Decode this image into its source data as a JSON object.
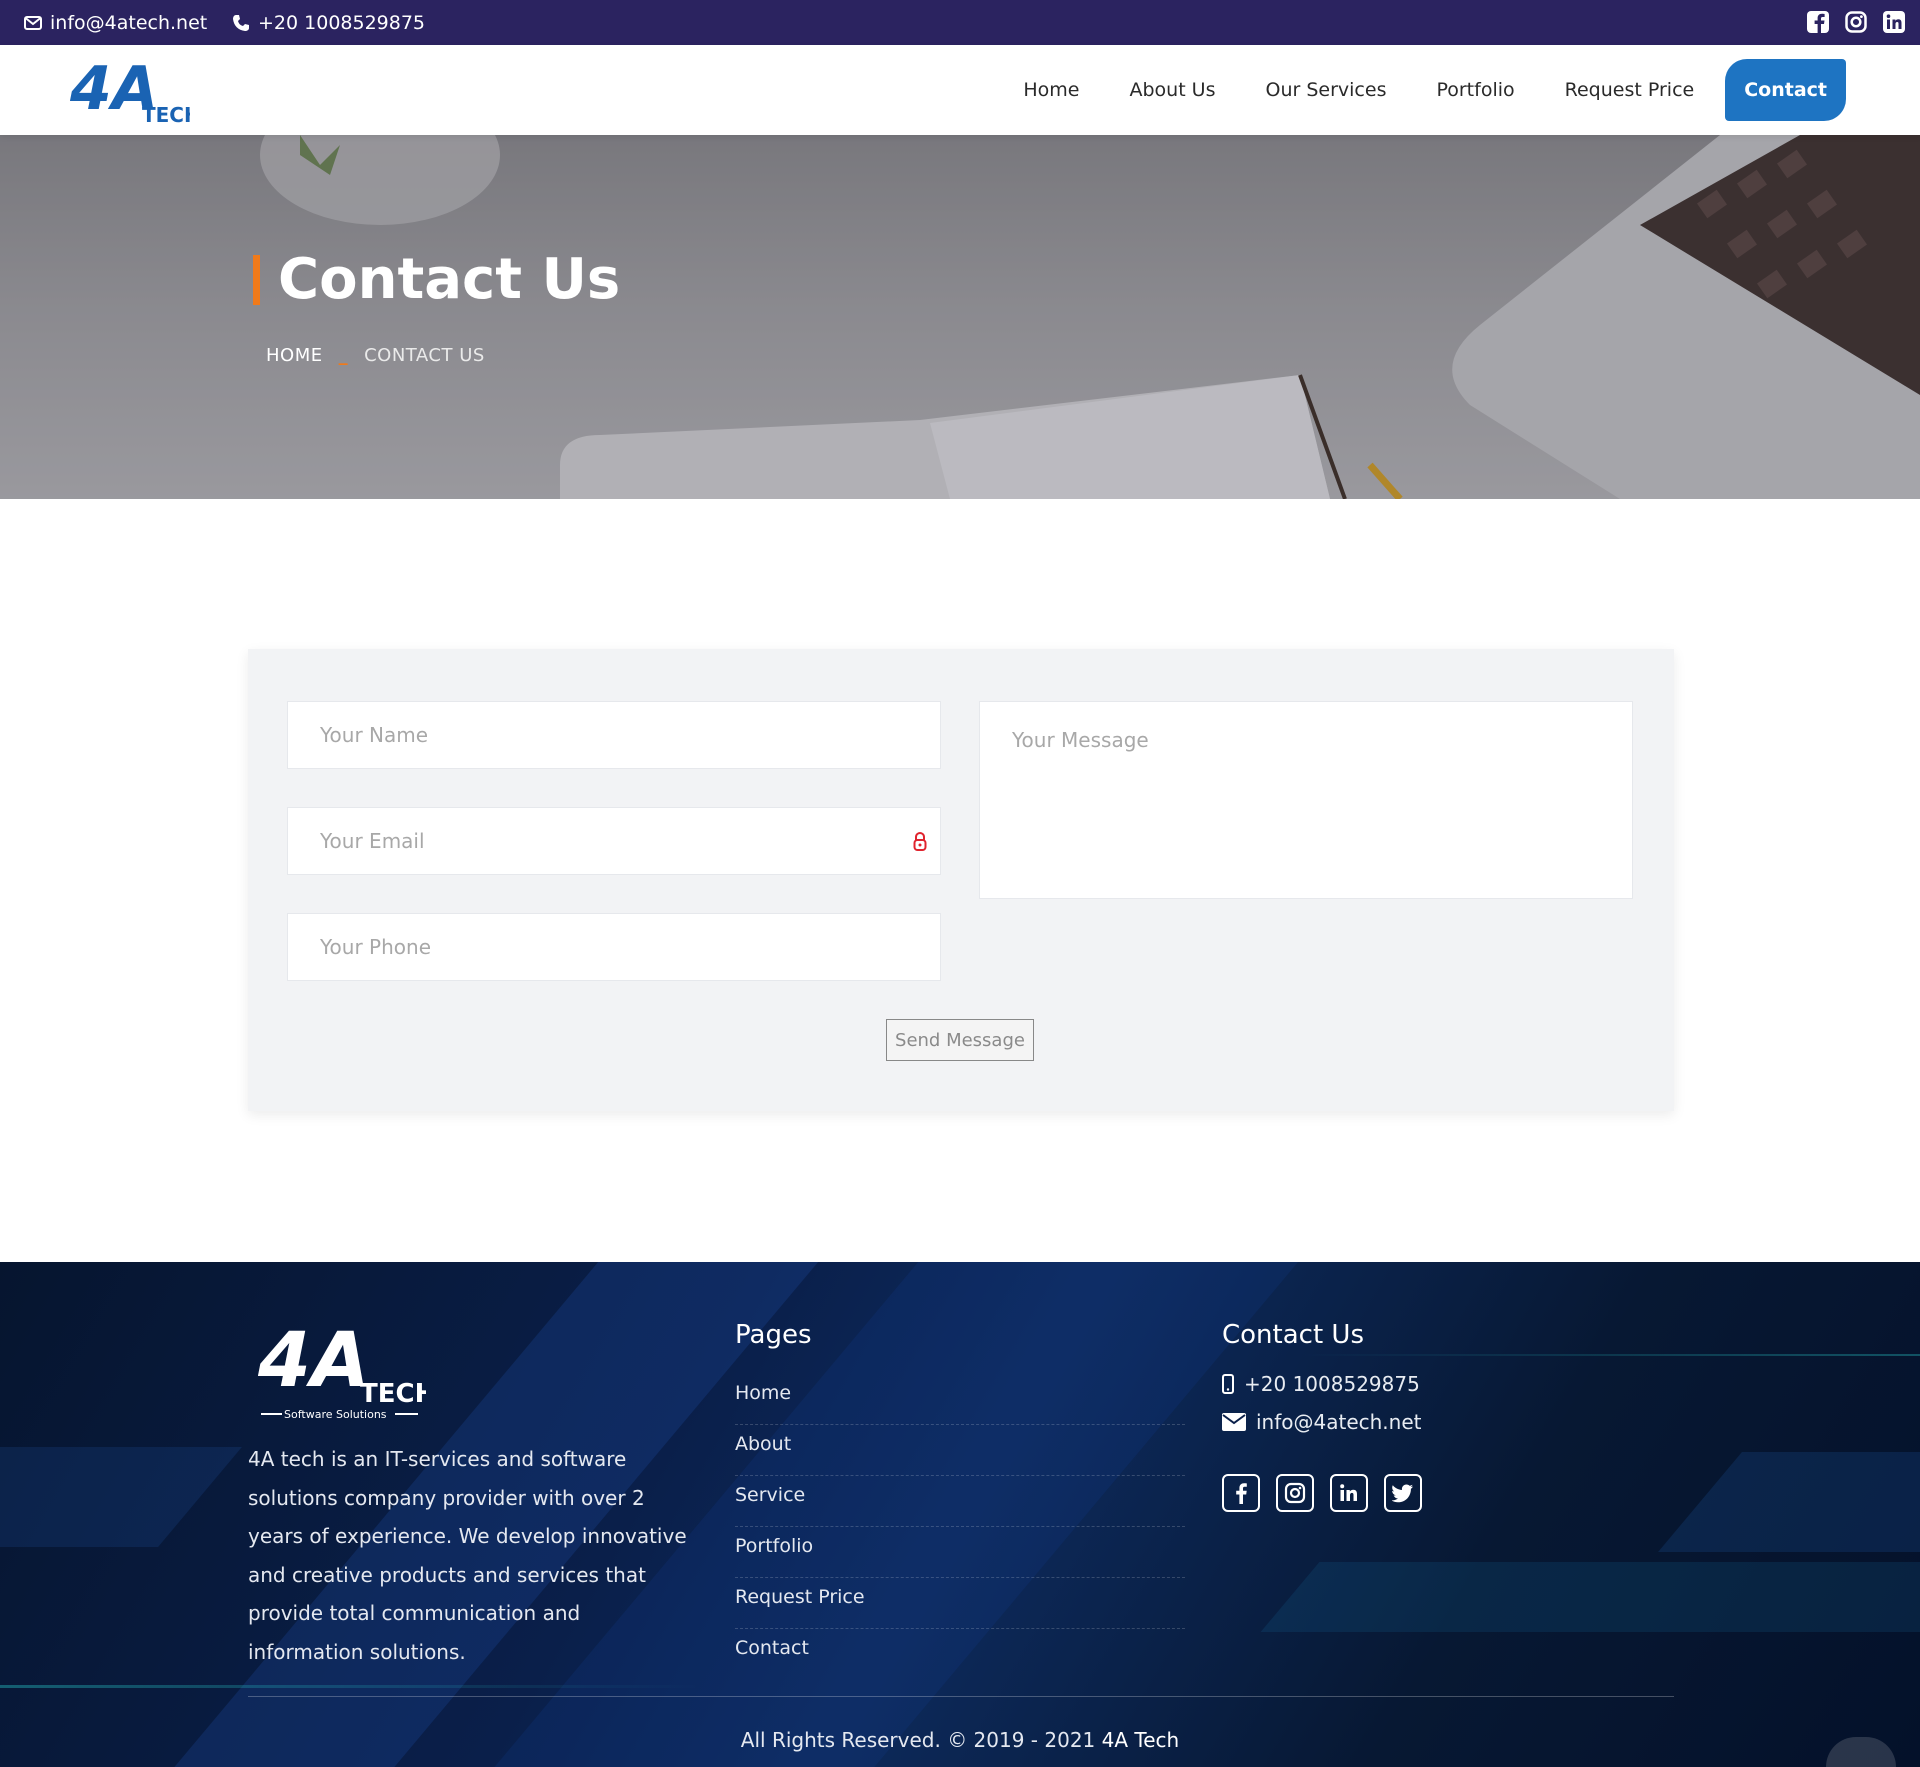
{
  "topbar": {
    "email": "info@4atech.net",
    "phone": "+20 1008529875",
    "social_icons": [
      "facebook-icon",
      "instagram-icon",
      "linkedin-icon"
    ]
  },
  "header": {
    "logo_text": "4A",
    "logo_sub": "TECH",
    "nav": [
      "Home",
      "About Us",
      "Our Services",
      "Portfolio",
      "Request Price",
      "Contact"
    ],
    "active_nav": "Contact"
  },
  "hero": {
    "title": "Contact Us",
    "breadcrumb_home": "HOME",
    "breadcrumb_sep": "_",
    "breadcrumb_current": "CONTACT US"
  },
  "form": {
    "name_placeholder": "Your Name",
    "email_placeholder": "Your Email",
    "phone_placeholder": "Your Phone",
    "message_placeholder": "Your Message",
    "send_label": "Send Message"
  },
  "footer": {
    "logo_text": "4A",
    "logo_sub": "TECH",
    "logo_tagline": "Software Solutions",
    "about": "4A tech is an IT-services and software solutions company provider with over 2 years of experience. We develop innovative and creative products and services that provide total communication and information solutions.",
    "pages_title": "Pages",
    "pages": [
      "Home",
      "About",
      "Service",
      "Portfolio",
      "Request Price",
      "Contact"
    ],
    "contact_title": "Contact Us",
    "contact_phone": "+20 1008529875",
    "contact_email": "info@4atech.net",
    "social_icons": [
      "facebook-icon",
      "instagram-icon",
      "linkedin-icon",
      "twitter-icon"
    ],
    "copyright": "All Rights Reserved. © 2019 - 2021",
    "copyright_brand": "4A Tech"
  },
  "colors": {
    "topbar": "#2b2360",
    "accent": "#1e74c2",
    "hero_marker": "#f07a1a",
    "form_bg": "#f2f3f5",
    "footer": "#0a1f4a"
  }
}
